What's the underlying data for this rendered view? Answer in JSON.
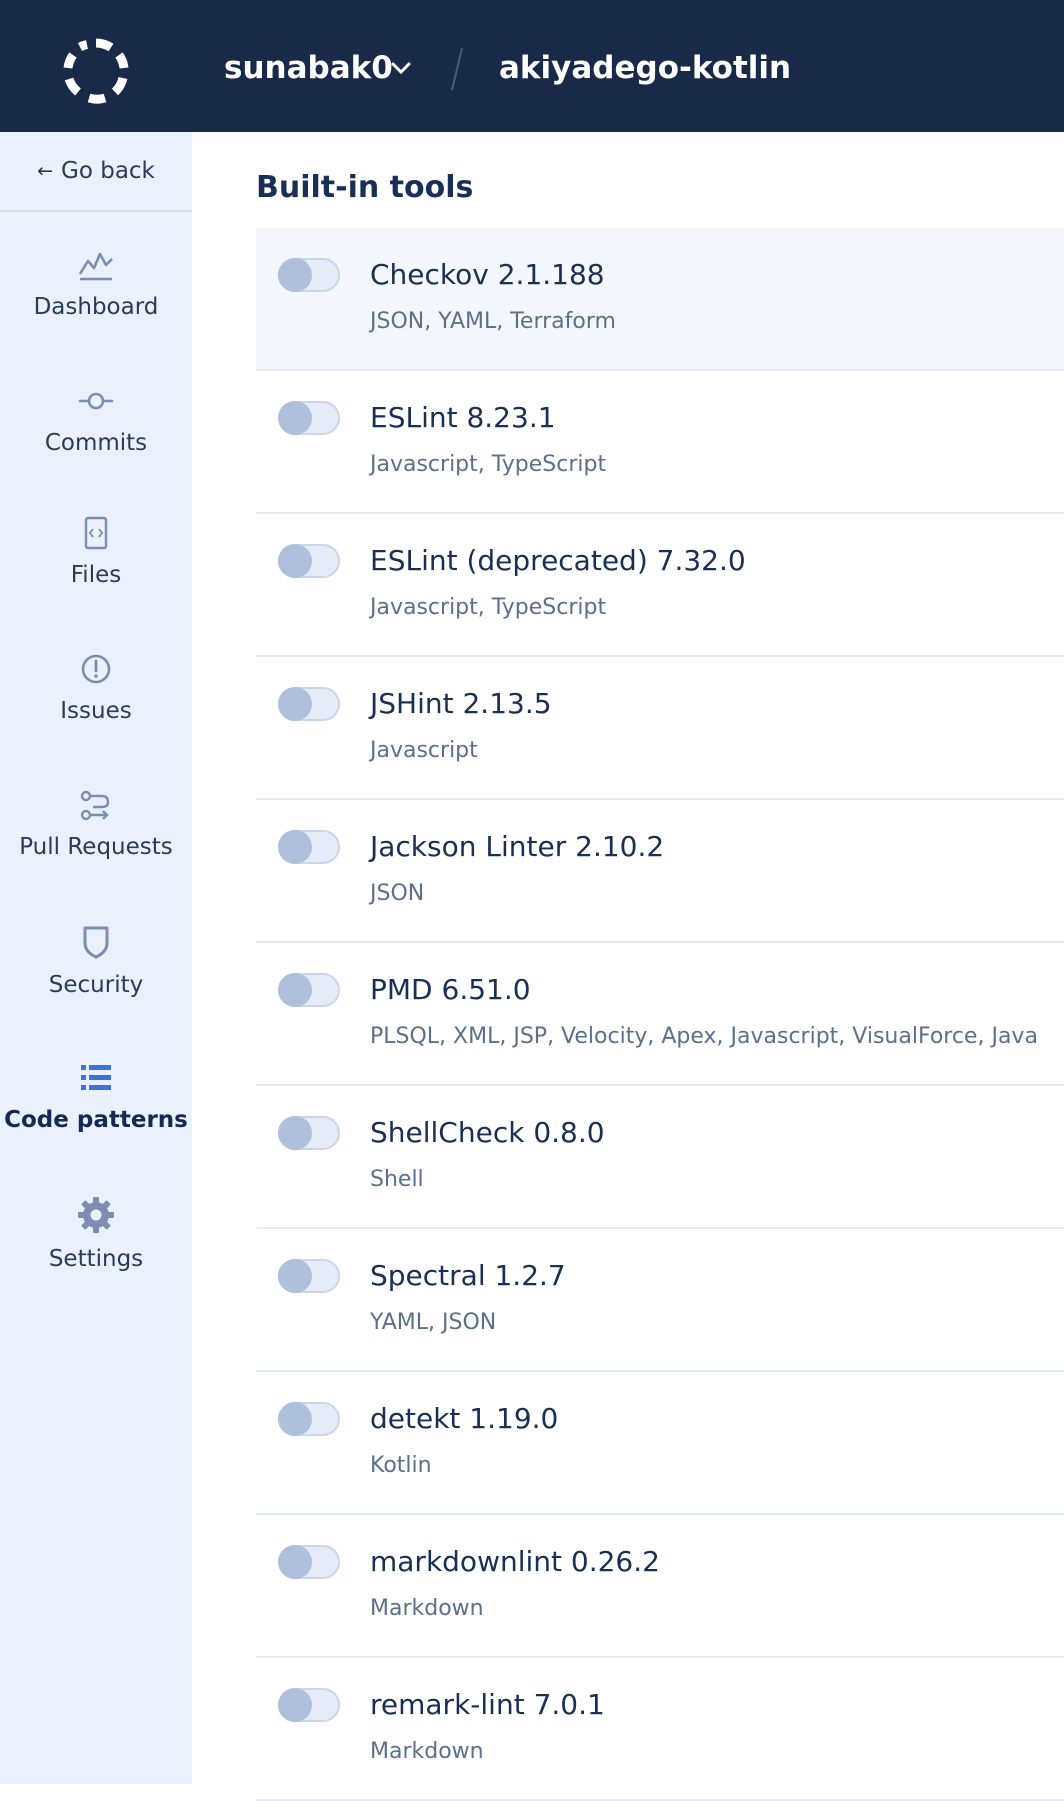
{
  "header": {
    "organization": "sunabak0",
    "repository": "akiyadego-kotlin"
  },
  "sidebar": {
    "go_back": "Go back",
    "items": [
      {
        "label": "Dashboard",
        "icon": "dashboard-icon"
      },
      {
        "label": "Commits",
        "icon": "commit-icon"
      },
      {
        "label": "Files",
        "icon": "file-code-icon"
      },
      {
        "label": "Issues",
        "icon": "alert-circle-icon"
      },
      {
        "label": "Pull Requests",
        "icon": "pull-request-icon"
      },
      {
        "label": "Security",
        "icon": "shield-icon"
      },
      {
        "label": "Code patterns",
        "icon": "list-icon",
        "active": true
      },
      {
        "label": "Settings",
        "icon": "gear-icon"
      }
    ]
  },
  "main": {
    "section_title": "Built-in tools",
    "tools": [
      {
        "name": "Checkov 2.1.188",
        "languages": "JSON, YAML, Terraform",
        "enabled": false
      },
      {
        "name": "ESLint 8.23.1",
        "languages": "Javascript, TypeScript",
        "enabled": false
      },
      {
        "name": "ESLint (deprecated) 7.32.0",
        "languages": "Javascript, TypeScript",
        "enabled": false
      },
      {
        "name": "JSHint 2.13.5",
        "languages": "Javascript",
        "enabled": false
      },
      {
        "name": "Jackson Linter 2.10.2",
        "languages": "JSON",
        "enabled": false
      },
      {
        "name": "PMD 6.51.0",
        "languages": "PLSQL, XML, JSP, Velocity, Apex, Javascript, VisualForce, Java",
        "enabled": false
      },
      {
        "name": "ShellCheck 0.8.0",
        "languages": "Shell",
        "enabled": false
      },
      {
        "name": "Spectral 1.2.7",
        "languages": "YAML, JSON",
        "enabled": false
      },
      {
        "name": "detekt 1.19.0",
        "languages": "Kotlin",
        "enabled": false
      },
      {
        "name": "markdownlint 0.26.2",
        "languages": "Markdown",
        "enabled": false
      },
      {
        "name": "remark-lint 7.0.1",
        "languages": "Markdown",
        "enabled": false
      }
    ]
  },
  "colors": {
    "header_bg": "#192a48",
    "sidebar_bg": "#eaf1fd",
    "active_icon": "#3d71e0",
    "text_primary": "#1a2f55"
  }
}
